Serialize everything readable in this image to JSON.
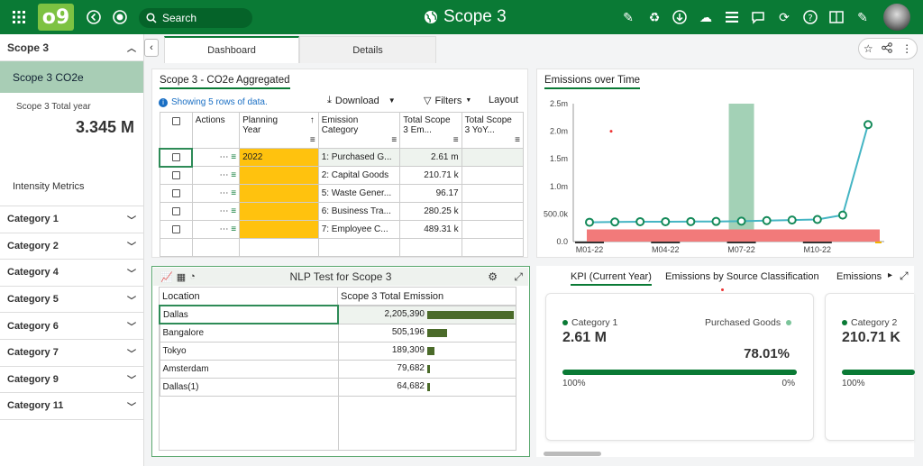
{
  "topbar": {
    "search_placeholder": "Search",
    "page_title": "Scope 3",
    "logo_text": "o9",
    "accent": "#0a7a35"
  },
  "sidebar": {
    "header": "Scope 3",
    "active_item": "Scope 3 CO2e",
    "total_label": "Scope 3 Total year",
    "total_value": "3.345 M",
    "intensity": "Intensity Metrics",
    "categories": [
      "Category 1",
      "Category 2",
      "Category 4",
      "Category 5",
      "Category 6",
      "Category 7",
      "Category 9",
      "Category 11"
    ]
  },
  "tabs": [
    "Dashboard",
    "Details"
  ],
  "aggregated": {
    "title": "Scope 3 - CO2e Aggregated",
    "info": "Showing 5 rows of data.",
    "download": "Download",
    "filters": "Filters",
    "layout": "Layout",
    "headers": {
      "actions": "Actions",
      "planning_year_1": "Planning",
      "planning_year_2": "Year",
      "category_1": "Emission",
      "category_2": "Category",
      "total_1": "Total Scope",
      "total_2": "3 Em...",
      "yoy_1": "Total Scope",
      "yoy_2": "3 YoY..."
    },
    "rows": [
      {
        "year": "2022",
        "category": "1: Purchased G...",
        "total": "2.61 m"
      },
      {
        "year": "",
        "category": "2: Capital Goods",
        "total": "210.71 k"
      },
      {
        "year": "",
        "category": "5: Waste Gener...",
        "total": "96.17"
      },
      {
        "year": "",
        "category": "6: Business Tra...",
        "total": "280.25 k"
      },
      {
        "year": "",
        "category": "7: Employee C...",
        "total": "489.31 k"
      }
    ]
  },
  "nlp": {
    "title": "NLP Test for Scope 3",
    "col_location": "Location",
    "col_total": "Scope 3 Total Emission",
    "rows": [
      {
        "location": "Dallas",
        "value": "2,205,390",
        "num": 2205390
      },
      {
        "location": "Bangalore",
        "value": "505,196",
        "num": 505196
      },
      {
        "location": "Tokyo",
        "value": "189,309",
        "num": 189309
      },
      {
        "location": "Amsterdam",
        "value": "79,682",
        "num": 79682
      },
      {
        "location": "Dallas(1)",
        "value": "64,682",
        "num": 64682
      }
    ]
  },
  "chart_data": {
    "type": "line",
    "title": "Emissions over Time",
    "yticks": [
      "2.5m",
      "2.0m",
      "1.5m",
      "1.0m",
      "500.0k",
      "0.0"
    ],
    "xticks": [
      "M01-22",
      "M04-22",
      "M07-22",
      "M10-22"
    ],
    "x": [
      "M01-22",
      "M02-22",
      "M03-22",
      "M04-22",
      "M05-22",
      "M06-22",
      "M07-22",
      "M08-22",
      "M09-22",
      "M10-22",
      "M11-22",
      "M12-22"
    ],
    "series": [
      {
        "values": [
          350000,
          355000,
          360000,
          360000,
          362000,
          365000,
          370000,
          380000,
          390000,
          400000,
          480000,
          2120000
        ]
      }
    ],
    "ylim": [
      0,
      2500000
    ],
    "line_color": "#45b5c4"
  },
  "kpi": {
    "tabs": [
      "KPI (Current Year)",
      "Emissions by Source Classification",
      "Emissions"
    ],
    "cards": [
      {
        "label": "Category 1",
        "value": "2.61 M",
        "right_label": "Purchased Goods",
        "pct": "78.01%",
        "left_pct": "100%",
        "right_pct": "0%",
        "fill": 1.0
      },
      {
        "label": "Category 2",
        "value": "210.71 K",
        "left_pct": "100%",
        "fill": 1.0
      }
    ]
  }
}
